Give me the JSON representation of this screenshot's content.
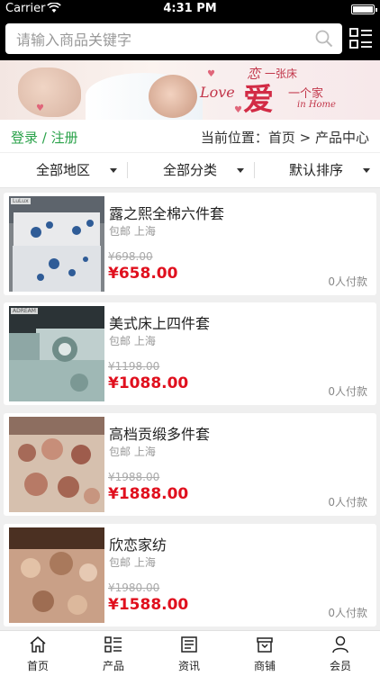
{
  "status": {
    "carrier": "Carrier",
    "time": "4:31 PM"
  },
  "search": {
    "placeholder": "请输入商品关键字"
  },
  "banner": {
    "line1": "恋",
    "line1b": "一张床",
    "line2": "Love",
    "big": "爱",
    "line4": "一个家",
    "line5": "in Home"
  },
  "location": {
    "login": "登录 / 注册",
    "path": "当前位置：首页 > 产品中心"
  },
  "filters": [
    {
      "label": "全部地区"
    },
    {
      "label": "全部分类"
    },
    {
      "label": "默认排序"
    }
  ],
  "products": [
    {
      "name": "露之熙全棉六件套",
      "ship": "包邮 上海",
      "old_price": "¥698.00",
      "price": "¥658.00",
      "paid": "0人付款",
      "tag": "LuLux"
    },
    {
      "name": "美式床上四件套",
      "ship": "包邮 上海",
      "old_price": "¥1198.00",
      "price": "¥1088.00",
      "paid": "0人付款",
      "tag": "ADREAM"
    },
    {
      "name": "高档贡缎多件套",
      "ship": "包邮 上海",
      "old_price": "¥1988.00",
      "price": "¥1888.00",
      "paid": "0人付款",
      "tag": ""
    },
    {
      "name": "欣恋家纺",
      "ship": "包邮 上海",
      "old_price": "¥1980.00",
      "price": "¥1588.00",
      "paid": "0人付款",
      "tag": ""
    }
  ],
  "tabs": [
    {
      "label": "首页",
      "icon": "home-icon"
    },
    {
      "label": "产品",
      "icon": "list-icon"
    },
    {
      "label": "资讯",
      "icon": "news-icon"
    },
    {
      "label": "商铺",
      "icon": "shop-icon"
    },
    {
      "label": "会员",
      "icon": "user-icon"
    }
  ],
  "colors": {
    "accent_green": "#2aa24a",
    "price_red": "#e0101e",
    "topbar": "#000000"
  }
}
